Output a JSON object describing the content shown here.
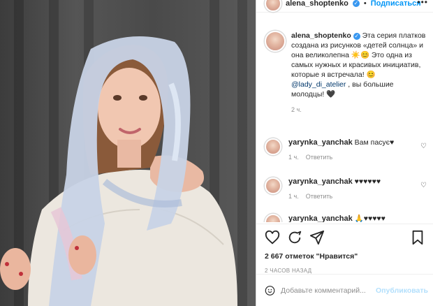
{
  "header": {
    "username": "alena_shoptenko",
    "follow_label": "Подписаться",
    "more_label": "•••"
  },
  "caption": {
    "username": "alena_shoptenko",
    "text_part1": "Эта серия платков создана из рисунков «детей солнца» и она великолепна ☀️😊 Это одна из самых нужных и красивых инициатив, которые я встречала! 😊",
    "mention": "@lady_di_atelier",
    "text_part2": ", вы большие молодцы! 🖤",
    "time": "2 ч."
  },
  "comments": [
    {
      "username": "yarynka_yanchak",
      "text": "Вам пасує♥",
      "time": "1 ч.",
      "reply_label": "Ответить"
    },
    {
      "username": "yarynka_yanchak",
      "text": "♥♥♥♥♥♥",
      "time": "1 ч.",
      "reply_label": "Ответить"
    },
    {
      "username": "yarynka_yanchak",
      "text": "🙏♥♥♥♥♥",
      "time": "",
      "reply_label": ""
    }
  ],
  "actions": {
    "icons": [
      "heart-icon",
      "comment-icon",
      "share-icon",
      "bookmark-icon"
    ],
    "likes": "2 667 отметок \"Нравится\"",
    "date": "2 ЧАСОВ НАЗАД"
  },
  "add_comment": {
    "placeholder": "Добавьте комментарий...",
    "publish_label": "Опубликовать"
  },
  "colors": {
    "accent": "#0095f6",
    "publish_disabled": "#b2dffc",
    "muted": "#8e8e8e",
    "text": "#262626"
  }
}
